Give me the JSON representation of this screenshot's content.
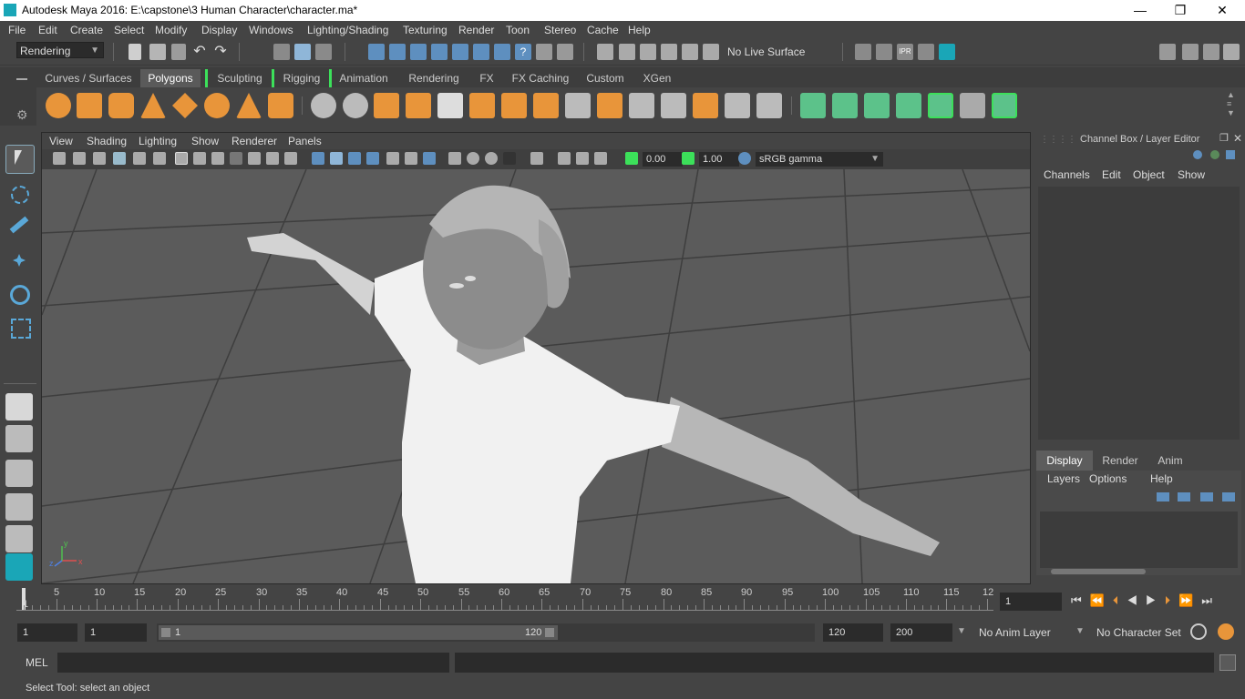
{
  "window": {
    "title": "Autodesk Maya 2016: E:\\capstone\\3 Human Character\\character.ma*",
    "minimize": "—",
    "restore": "❐",
    "close": "✕"
  },
  "menubar": {
    "items": [
      "File",
      "Edit",
      "Create",
      "Select",
      "Modify",
      "Display",
      "Windows",
      "Lighting/Shading",
      "Texturing",
      "Render",
      "Toon",
      "Stereo",
      "Cache",
      "Help"
    ]
  },
  "statusline": {
    "menuset": "Rendering",
    "live_surface": "No Live Surface"
  },
  "shelf": {
    "tabs": [
      "Curves / Surfaces",
      "Polygons",
      "Sculpting",
      "Rigging",
      "Animation",
      "Rendering",
      "FX",
      "FX Caching",
      "Custom",
      "XGen"
    ],
    "active_tab": "Polygons"
  },
  "viewport": {
    "menu": [
      "View",
      "Shading",
      "Lighting",
      "Show",
      "Renderer",
      "Panels"
    ],
    "exposure": "0.00",
    "gamma": "1.00",
    "color_space": "sRGB gamma",
    "axis_labels": {
      "x": "x",
      "y": "y",
      "z": "z"
    }
  },
  "channelbox": {
    "title": "Channel Box / Layer Editor",
    "menu": [
      "Channels",
      "Edit",
      "Object",
      "Show"
    ],
    "layer_tabs": [
      "Display",
      "Render",
      "Anim"
    ],
    "active_layer_tab": "Display",
    "layer_menu": [
      "Layers",
      "Options",
      "Help"
    ]
  },
  "timeslider": {
    "labels": [
      "5",
      "10",
      "15",
      "20",
      "25",
      "30",
      "35",
      "40",
      "45",
      "50",
      "55",
      "60",
      "65",
      "70",
      "75",
      "80",
      "85",
      "90",
      "95",
      "100",
      "105",
      "110",
      "115",
      "12"
    ],
    "current_frame_marker": "1",
    "current_frame": "1"
  },
  "rangeslider": {
    "start_frame": "1",
    "range_start": "1",
    "range_start_inner": "1",
    "range_end_inner": "120",
    "range_end": "120",
    "end_frame": "200",
    "anim_layer": "No Anim Layer",
    "character_set": "No Character Set"
  },
  "commandline": {
    "lang": "MEL"
  },
  "helpline": {
    "text": "Select Tool: select an object"
  },
  "colors": {
    "accent_teal": "#1aa6b7",
    "shelf_orange": "#e8953a",
    "shelf_green": "#5cc28a",
    "bracket_green": "#3ce05a",
    "viewport_bg": "#5b5b5b"
  }
}
